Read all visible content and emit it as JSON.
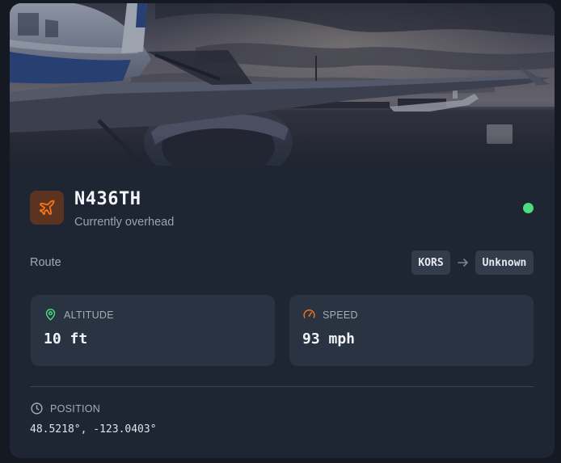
{
  "flight": {
    "callsign": "N436TH",
    "subtitle": "Currently overhead",
    "status_color": "#4ade80"
  },
  "route": {
    "label": "Route",
    "from": "KORS",
    "to": "Unknown"
  },
  "stats": {
    "altitude": {
      "label": "ALTITUDE",
      "value": "10 ft",
      "icon": "map-pin-icon",
      "icon_color": "#4ade80"
    },
    "speed": {
      "label": "SPEED",
      "value": "93 mph",
      "icon": "gauge-icon",
      "icon_color": "#f97316"
    }
  },
  "position": {
    "label": "POSITION",
    "value": "48.5218°, -123.0403°",
    "icon": "clock-icon"
  },
  "colors": {
    "card_bg": "#1e2633",
    "tile_bg": "#2a3342",
    "accent_orange": "#f97316",
    "badge_bg": "#5a3421"
  }
}
